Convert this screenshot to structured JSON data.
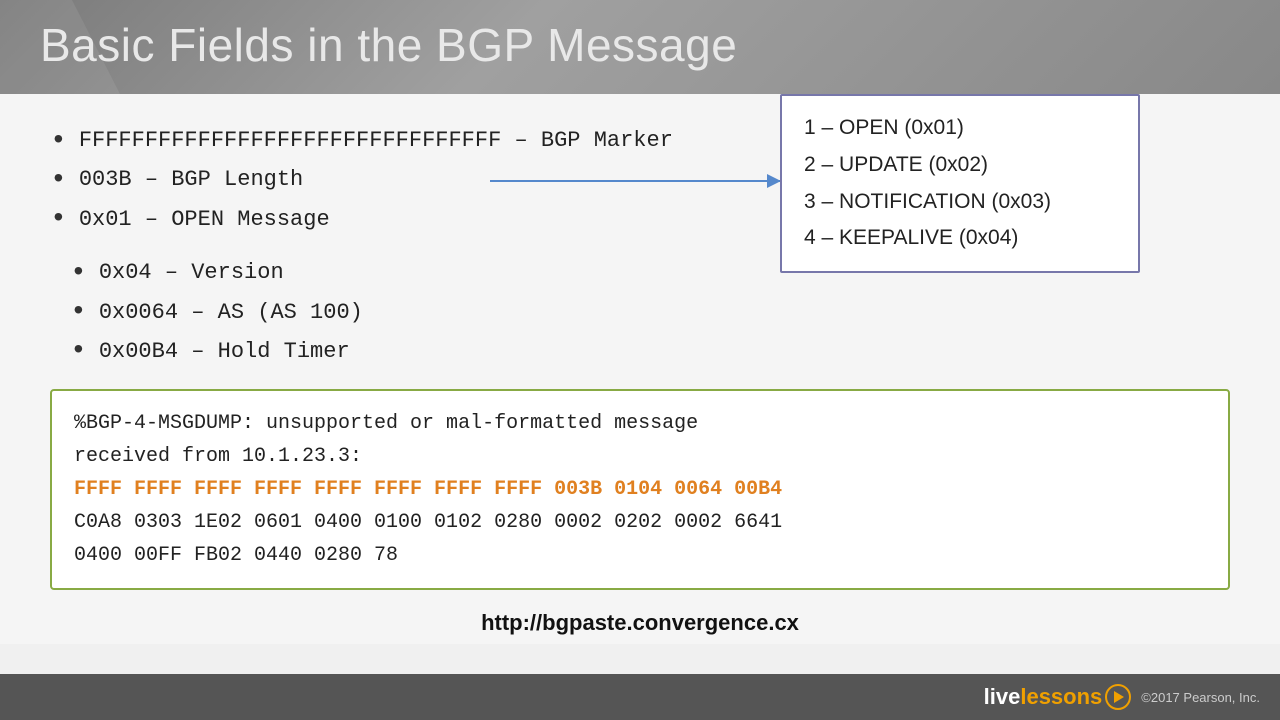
{
  "header": {
    "title": "Basic Fields in the BGP Message"
  },
  "bullets": [
    {
      "text": "FFFFFFFFFFFFFFFFFFFFFFFFFFFFFFFF – BGP Marker",
      "sub": []
    },
    {
      "text": "003B – BGP Length",
      "sub": []
    },
    {
      "text": "0x01 – OPEN Message",
      "sub": [
        "0x04 – Version",
        "0x0064 – AS (AS 100)",
        "0x00B4 – Hold Timer"
      ]
    }
  ],
  "popup": {
    "items": [
      "1 – OPEN (0x01)",
      "2 – UPDATE (0x02)",
      "3 – NOTIFICATION (0x03)",
      "4 – KEEPALIVE (0x04)"
    ]
  },
  "codebox": {
    "line1": "%BGP-4-MSGDUMP: unsupported or mal-formatted message",
    "line2": "received from 10.1.23.3:",
    "line3_highlight": "FFFF FFFF FFFF FFFF FFFF FFFF FFFF FFFF 003B 0104 0064 00B4",
    "line4": "C0A8 0303 1E02 0601 0400 0100 0102 0280 0002 0202 0002 6641",
    "line5": "0400 00FF FB02 0440 0280 78"
  },
  "url": "http://bgpaste.convergence.cx",
  "footer": {
    "logo_live": "live",
    "logo_lessons": "lessons",
    "copyright": "©2017 Pearson, Inc."
  }
}
